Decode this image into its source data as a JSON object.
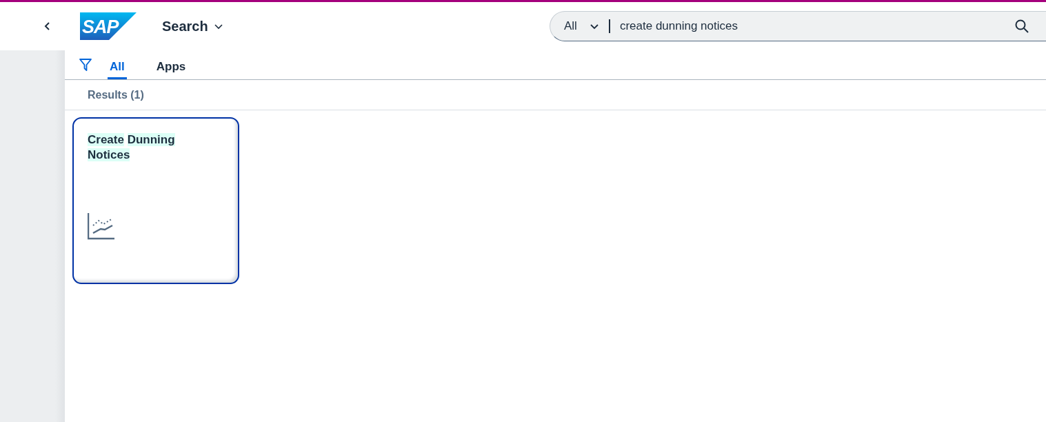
{
  "header": {
    "logo": "SAP",
    "title": "Search"
  },
  "search": {
    "scope": "All",
    "value": "create dunning notices"
  },
  "tabs": [
    {
      "label": "All",
      "selected": true
    },
    {
      "label": "Apps",
      "selected": false
    }
  ],
  "results_heading": "Results (1)",
  "tiles": [
    {
      "title": "Create Dunning Notices",
      "highlighted": true
    }
  ]
}
